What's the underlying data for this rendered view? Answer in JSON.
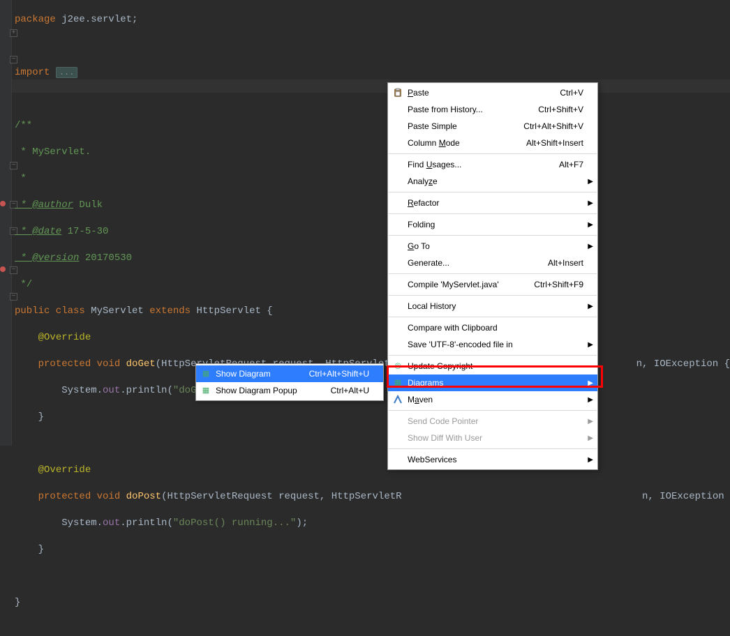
{
  "code": {
    "pkg_kw": "package",
    "pkg_name": " j2ee.servlet;",
    "imp_kw": "import",
    "imp_folded": "...",
    "doc1": "/**",
    "doc2": " * MyServlet.",
    "doc3": " *",
    "doc_author_tag": " * @author",
    "doc_author_val": " Dulk",
    "doc_date_tag": " * @date",
    "doc_date_val": " 17-5-30",
    "doc_ver_tag": " * @version",
    "doc_ver_val": " 20170530",
    "doc_end": " */",
    "cls_kw1": "public class ",
    "cls_name": "MyServlet",
    "cls_kw2": " extends ",
    "cls_sup": "HttpServlet",
    "cls_open": " {",
    "override": "@Override",
    "m1_kw": "protected void ",
    "m1_name": "doGet",
    "m1_sig1": "(HttpServletRequest request, HttpServletR",
    "m1_sig2_tail": "n, IOException {",
    "m1_body_a": "System.",
    "m1_body_b": "out",
    "m1_body_c": ".println(",
    "m1_body_str": "\"doGet() running...\"",
    "m1_body_d": ");",
    "brace_close": "}",
    "m2_kw": "protected void ",
    "m2_name": "doPost",
    "m2_sig1": "(HttpServletRequest request, HttpServletR",
    "m2_sig2_tail": "n, IOException {",
    "m2_body_a": "System.",
    "m2_body_b": "out",
    "m2_body_c": ".println(",
    "m2_body_str": "\"doPost() running...\"",
    "m2_body_d": ");"
  },
  "mainMenu": {
    "paste": {
      "label_pre": "",
      "label_u": "P",
      "label_post": "aste",
      "shortcut": "Ctrl+V"
    },
    "pasteHistory": {
      "label": "Paste from History...",
      "shortcut": "Ctrl+Shift+V"
    },
    "pasteSimple": {
      "label": "Paste Simple",
      "shortcut": "Ctrl+Alt+Shift+V"
    },
    "columnMode": {
      "label_pre": "Column ",
      "label_u": "M",
      "label_post": "ode",
      "shortcut": "Alt+Shift+Insert"
    },
    "findUsages": {
      "label_pre": "Find ",
      "label_u": "U",
      "label_post": "sages...",
      "shortcut": "Alt+F7"
    },
    "analyze": {
      "label_pre": "Analy",
      "label_u": "z",
      "label_post": "e"
    },
    "refactor": {
      "label_pre": "",
      "label_u": "R",
      "label_post": "efactor"
    },
    "folding": {
      "label": "Folding"
    },
    "goto": {
      "label_pre": "",
      "label_u": "G",
      "label_post": "o To"
    },
    "generate": {
      "label": "Generate...",
      "shortcut": "Alt+Insert"
    },
    "compile": {
      "label": "Compile 'MyServlet.java'",
      "shortcut": "Ctrl+Shift+F9"
    },
    "localHistory": {
      "label": "Local History"
    },
    "compareClip": {
      "label": "Compare with Clipboard"
    },
    "saveEnc": {
      "label": "Save 'UTF-8'-encoded file in"
    },
    "updateCopy": {
      "label": "Update Copyright"
    },
    "diagrams": {
      "label_pre": "",
      "label_u": "D",
      "label_post": "iagrams"
    },
    "maven": {
      "label_pre": "M",
      "label_u": "a",
      "label_post": "ven"
    },
    "sendPtr": {
      "label": "Send Code Pointer"
    },
    "showDiff": {
      "label": "Show Diff With User"
    },
    "webSvc": {
      "label": "WebServices"
    }
  },
  "subMenu": {
    "showDiagram": {
      "label": "Show Diagram",
      "shortcut": "Ctrl+Alt+Shift+U"
    },
    "showDiagramPopup": {
      "label": "Show Diagram Popup",
      "shortcut": "Ctrl+Alt+U"
    }
  }
}
